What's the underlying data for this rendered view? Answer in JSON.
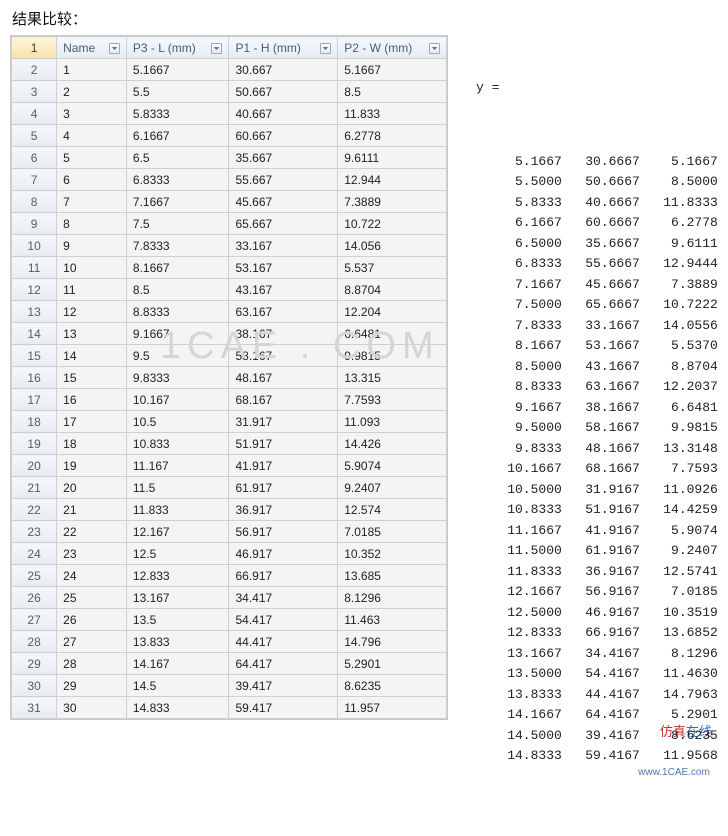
{
  "title": "结果比较：",
  "table": {
    "corner": "1",
    "headers": [
      "Name",
      "P3 - L (mm)",
      "P1 - H (mm)",
      "P2 - W (mm)"
    ],
    "rows": [
      {
        "n": "2",
        "name": "1",
        "p3": "5.1667",
        "p1": "30.667",
        "p2": "5.1667"
      },
      {
        "n": "3",
        "name": "2",
        "p3": "5.5",
        "p1": "50.667",
        "p2": "8.5"
      },
      {
        "n": "4",
        "name": "3",
        "p3": "5.8333",
        "p1": "40.667",
        "p2": "11.833"
      },
      {
        "n": "5",
        "name": "4",
        "p3": "6.1667",
        "p1": "60.667",
        "p2": "6.2778"
      },
      {
        "n": "6",
        "name": "5",
        "p3": "6.5",
        "p1": "35.667",
        "p2": "9.6111"
      },
      {
        "n": "7",
        "name": "6",
        "p3": "6.8333",
        "p1": "55.667",
        "p2": "12.944"
      },
      {
        "n": "8",
        "name": "7",
        "p3": "7.1667",
        "p1": "45.667",
        "p2": "7.3889"
      },
      {
        "n": "9",
        "name": "8",
        "p3": "7.5",
        "p1": "65.667",
        "p2": "10.722"
      },
      {
        "n": "10",
        "name": "9",
        "p3": "7.8333",
        "p1": "33.167",
        "p2": "14.056"
      },
      {
        "n": "11",
        "name": "10",
        "p3": "8.1667",
        "p1": "53.167",
        "p2": "5.537"
      },
      {
        "n": "12",
        "name": "11",
        "p3": "8.5",
        "p1": "43.167",
        "p2": "8.8704"
      },
      {
        "n": "13",
        "name": "12",
        "p3": "8.8333",
        "p1": "63.167",
        "p2": "12.204"
      },
      {
        "n": "14",
        "name": "13",
        "p3": "9.1667",
        "p1": "38.167",
        "p2": "6.6481"
      },
      {
        "n": "15",
        "name": "14",
        "p3": "9.5",
        "p1": "58.167",
        "p2": "9.9815"
      },
      {
        "n": "16",
        "name": "15",
        "p3": "9.8333",
        "p1": "48.167",
        "p2": "13.315"
      },
      {
        "n": "17",
        "name": "16",
        "p3": "10.167",
        "p1": "68.167",
        "p2": "7.7593"
      },
      {
        "n": "18",
        "name": "17",
        "p3": "10.5",
        "p1": "31.917",
        "p2": "11.093"
      },
      {
        "n": "19",
        "name": "18",
        "p3": "10.833",
        "p1": "51.917",
        "p2": "14.426"
      },
      {
        "n": "20",
        "name": "19",
        "p3": "11.167",
        "p1": "41.917",
        "p2": "5.9074"
      },
      {
        "n": "21",
        "name": "20",
        "p3": "11.5",
        "p1": "61.917",
        "p2": "9.2407"
      },
      {
        "n": "22",
        "name": "21",
        "p3": "11.833",
        "p1": "36.917",
        "p2": "12.574"
      },
      {
        "n": "23",
        "name": "22",
        "p3": "12.167",
        "p1": "56.917",
        "p2": "7.0185"
      },
      {
        "n": "24",
        "name": "23",
        "p3": "12.5",
        "p1": "46.917",
        "p2": "10.352"
      },
      {
        "n": "25",
        "name": "24",
        "p3": "12.833",
        "p1": "66.917",
        "p2": "13.685"
      },
      {
        "n": "26",
        "name": "25",
        "p3": "13.167",
        "p1": "34.417",
        "p2": "8.1296"
      },
      {
        "n": "27",
        "name": "26",
        "p3": "13.5",
        "p1": "54.417",
        "p2": "11.463"
      },
      {
        "n": "28",
        "name": "27",
        "p3": "13.833",
        "p1": "44.417",
        "p2": "14.796"
      },
      {
        "n": "29",
        "name": "28",
        "p3": "14.167",
        "p1": "64.417",
        "p2": "5.2901"
      },
      {
        "n": "30",
        "name": "29",
        "p3": "14.5",
        "p1": "39.417",
        "p2": "8.6235"
      },
      {
        "n": "31",
        "name": "30",
        "p3": "14.833",
        "p1": "59.417",
        "p2": "11.957"
      }
    ]
  },
  "right": {
    "var": "y =",
    "rows": [
      [
        "5.1667",
        "30.6667",
        "5.1667"
      ],
      [
        "5.5000",
        "50.6667",
        "8.5000"
      ],
      [
        "5.8333",
        "40.6667",
        "11.8333"
      ],
      [
        "6.1667",
        "60.6667",
        "6.2778"
      ],
      [
        "6.5000",
        "35.6667",
        "9.6111"
      ],
      [
        "6.8333",
        "55.6667",
        "12.9444"
      ],
      [
        "7.1667",
        "45.6667",
        "7.3889"
      ],
      [
        "7.5000",
        "65.6667",
        "10.7222"
      ],
      [
        "7.8333",
        "33.1667",
        "14.0556"
      ],
      [
        "8.1667",
        "53.1667",
        "5.5370"
      ],
      [
        "8.5000",
        "43.1667",
        "8.8704"
      ],
      [
        "8.8333",
        "63.1667",
        "12.2037"
      ],
      [
        "9.1667",
        "38.1667",
        "6.6481"
      ],
      [
        "9.5000",
        "58.1667",
        "9.9815"
      ],
      [
        "9.8333",
        "48.1667",
        "13.3148"
      ],
      [
        "10.1667",
        "68.1667",
        "7.7593"
      ],
      [
        "10.5000",
        "31.9167",
        "11.0926"
      ],
      [
        "10.8333",
        "51.9167",
        "14.4259"
      ],
      [
        "11.1667",
        "41.9167",
        "5.9074"
      ],
      [
        "11.5000",
        "61.9167",
        "9.2407"
      ],
      [
        "11.8333",
        "36.9167",
        "12.5741"
      ],
      [
        "12.1667",
        "56.9167",
        "7.0185"
      ],
      [
        "12.5000",
        "46.9167",
        "10.3519"
      ],
      [
        "12.8333",
        "66.9167",
        "13.6852"
      ],
      [
        "13.1667",
        "34.4167",
        "8.1296"
      ],
      [
        "13.5000",
        "54.4167",
        "11.4630"
      ],
      [
        "13.8333",
        "44.4167",
        "14.7963"
      ],
      [
        "14.1667",
        "64.4167",
        "5.2901"
      ],
      [
        "14.5000",
        "39.4167",
        "8.6235"
      ],
      [
        "14.8333",
        "59.4167",
        "11.9568"
      ]
    ]
  },
  "watermarks": {
    "wm1": "1CAE . COM",
    "wm2a": "仿真",
    "wm2b": "在线",
    "wm2_site": "www.1CAE.com"
  }
}
